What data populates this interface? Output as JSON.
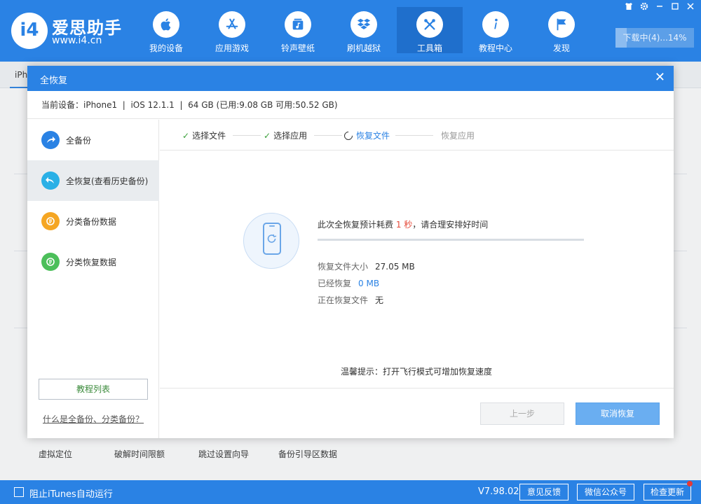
{
  "app": {
    "name": "爱思助手",
    "url": "www.i4.cn",
    "logo_text": "i4"
  },
  "nav": [
    {
      "label": "我的设备",
      "icon": "apple-icon"
    },
    {
      "label": "应用游戏",
      "icon": "app-store-icon"
    },
    {
      "label": "铃声壁纸",
      "icon": "music-icon"
    },
    {
      "label": "刷机越狱",
      "icon": "dropbox-icon"
    },
    {
      "label": "工具箱",
      "icon": "tools-icon",
      "active": true
    },
    {
      "label": "教程中心",
      "icon": "info-icon"
    },
    {
      "label": "发现",
      "icon": "flag-icon"
    }
  ],
  "window": {
    "controls": [
      "shirt-icon",
      "gear-icon",
      "minimize-icon",
      "maximize-icon",
      "close-icon"
    ],
    "download_label": "下载中(4)...14%",
    "download_progress": 0.14
  },
  "background": {
    "tab_label": "iPh",
    "tools": [
      "虚拟定位",
      "破解时间限额",
      "跳过设置向导",
      "备份引导区数据"
    ]
  },
  "statusbar": {
    "itunes_label": "阻止iTunes自动运行",
    "version": "V7.98.02",
    "feedback": "意见反馈",
    "wechat": "微信公众号",
    "update": "检查更新"
  },
  "modal": {
    "title": "全恢复",
    "close": "✕",
    "device_info": "当前设备：iPhone1  |  iOS 12.1.1  |  64 GB (已用:9.08 GB 可用:50.52 GB)",
    "side": [
      {
        "label": "全备份",
        "color": "#2a82e4"
      },
      {
        "label": "全恢复(查看历史备份)",
        "color": "#2ab0e6",
        "active": true
      },
      {
        "label": "分类备份数据",
        "color": "#f5a623"
      },
      {
        "label": "分类恢复数据",
        "color": "#4cbf5a"
      }
    ],
    "tutorial_button": "教程列表",
    "help_link": "什么是全备份、分类备份？",
    "steps": [
      {
        "label": "选择文件",
        "state": "done"
      },
      {
        "label": "选择应用",
        "state": "done"
      },
      {
        "label": "恢复文件",
        "state": "current"
      },
      {
        "label": "恢复应用",
        "state": "pending"
      }
    ],
    "estimate_prefix": "此次全恢复预计耗费 ",
    "estimate_value": "1 秒",
    "estimate_suffix": "，请合理安排好时间",
    "progress": 0,
    "file_size_label": "恢复文件大小",
    "file_size_value": "27.05 MB",
    "restored_label": "已经恢复",
    "restored_value": "0 MB",
    "current_file_label": "正在恢复文件",
    "current_file_value": "无",
    "tip": "温馨提示：打开飞行模式可增加恢复速度",
    "prev_button": "上一步",
    "cancel_button": "取消恢复"
  }
}
